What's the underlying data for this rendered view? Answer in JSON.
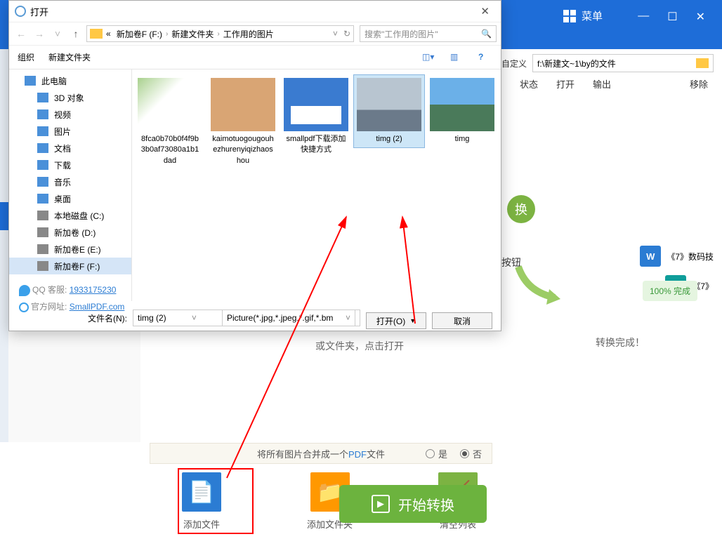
{
  "app": {
    "menu_label": "菜单",
    "toolbar_custom": "自定义",
    "path_value": "f:\\新建文~1\\by的文件",
    "columns": {
      "status": "状态",
      "open": "打开",
      "output": "输出",
      "remove": "移除"
    },
    "convert_char": "换",
    "btn_hint": "按钮",
    "files": {
      "word_name": "《7》数码技",
      "txt_name": "《7》"
    },
    "done_badge": "100% 完成",
    "convert_done": "转换完成！",
    "center_text": "或文件夹，点击打开",
    "merge_text_pre": "将所有图片合并成一个",
    "merge_text_pdf": "PDF",
    "merge_text_post": "文件",
    "radio_yes": "是",
    "radio_no": "否",
    "actions": {
      "add_file": "添加文件",
      "add_folder": "添加文件夹",
      "clear": "清空列表"
    },
    "start_btn": "开始转换",
    "qq_label": "QQ 客服:",
    "qq_num": "1933175230",
    "site_label": "官方网址:",
    "site_url": "SmallPDF.com"
  },
  "dialog": {
    "title": "打开",
    "breadcrumbs": {
      "prefix": "«",
      "d1": "新加卷F (F:)",
      "d2": "新建文件夹",
      "d3": "工作用的图片"
    },
    "search_placeholder": "搜索\"工作用的图片\"",
    "toolbar": {
      "organize": "组织",
      "new_folder": "新建文件夹"
    },
    "sidebar": {
      "pc": "此电脑",
      "obj3d": "3D 对象",
      "video": "视频",
      "pictures": "图片",
      "docs": "文档",
      "downloads": "下载",
      "music": "音乐",
      "desktop": "桌面",
      "drive_c": "本地磁盘 (C:)",
      "drive_d": "新加卷 (D:)",
      "drive_e": "新加卷E (E:)",
      "drive_f": "新加卷F (F:)"
    },
    "files": [
      {
        "name": "8fca0b70b0f4f9b3b0af73080a1b1dad"
      },
      {
        "name": "kaimotuogougouhezhurenyiqizhaoshou"
      },
      {
        "name": "smallpdf下载添加快捷方式"
      },
      {
        "name": "timg (2)"
      },
      {
        "name": "timg"
      }
    ],
    "filename_label": "文件名(N):",
    "filename_value": "timg (2)",
    "filetype": "Picture(*.jpg,*.jpeg,*.gif,*.bm",
    "open_btn": "打开(O)",
    "cancel_btn": "取消"
  }
}
